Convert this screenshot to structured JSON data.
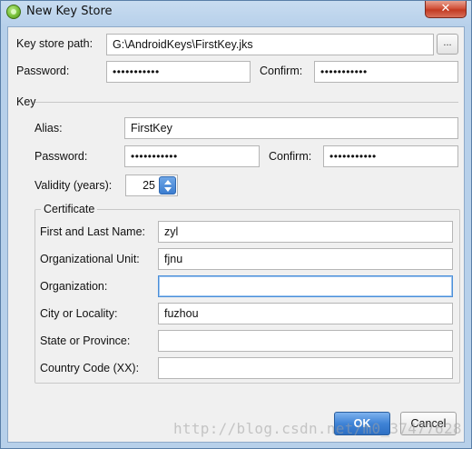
{
  "window": {
    "title": "New Key Store",
    "close_label": "✕"
  },
  "keystore": {
    "path_label": "Key store path:",
    "path_value": "G:\\AndroidKeys\\FirstKey.jks",
    "browse_label": "...",
    "password_label": "Password:",
    "password_value": "•••••••••••",
    "confirm_label": "Confirm:",
    "confirm_value": "•••••••••••"
  },
  "key": {
    "section_label": "Key",
    "alias_label": "Alias:",
    "alias_value": "FirstKey",
    "password_label": "Password:",
    "password_value": "•••••••••••",
    "confirm_label": "Confirm:",
    "confirm_value": "•••••••••••",
    "validity_label": "Validity (years):",
    "validity_value": "25"
  },
  "certificate": {
    "legend": "Certificate",
    "fields": [
      {
        "label": "First and Last Name:",
        "value": "zyl"
      },
      {
        "label": "Organizational Unit:",
        "value": "fjnu"
      },
      {
        "label": "Organization:",
        "value": ""
      },
      {
        "label": "City or Locality:",
        "value": "fuzhou"
      },
      {
        "label": "State or Province:",
        "value": ""
      },
      {
        "label": "Country Code (XX):",
        "value": ""
      }
    ]
  },
  "buttons": {
    "ok": "OK",
    "cancel": "Cancel"
  },
  "watermark": "http://blog.csdn.net/m0_37477628",
  "icons": [
    "android-studio-icon",
    "close-icon",
    "browse-icon",
    "spinner-arrow-up-icon",
    "spinner-arrow-down-icon"
  ]
}
